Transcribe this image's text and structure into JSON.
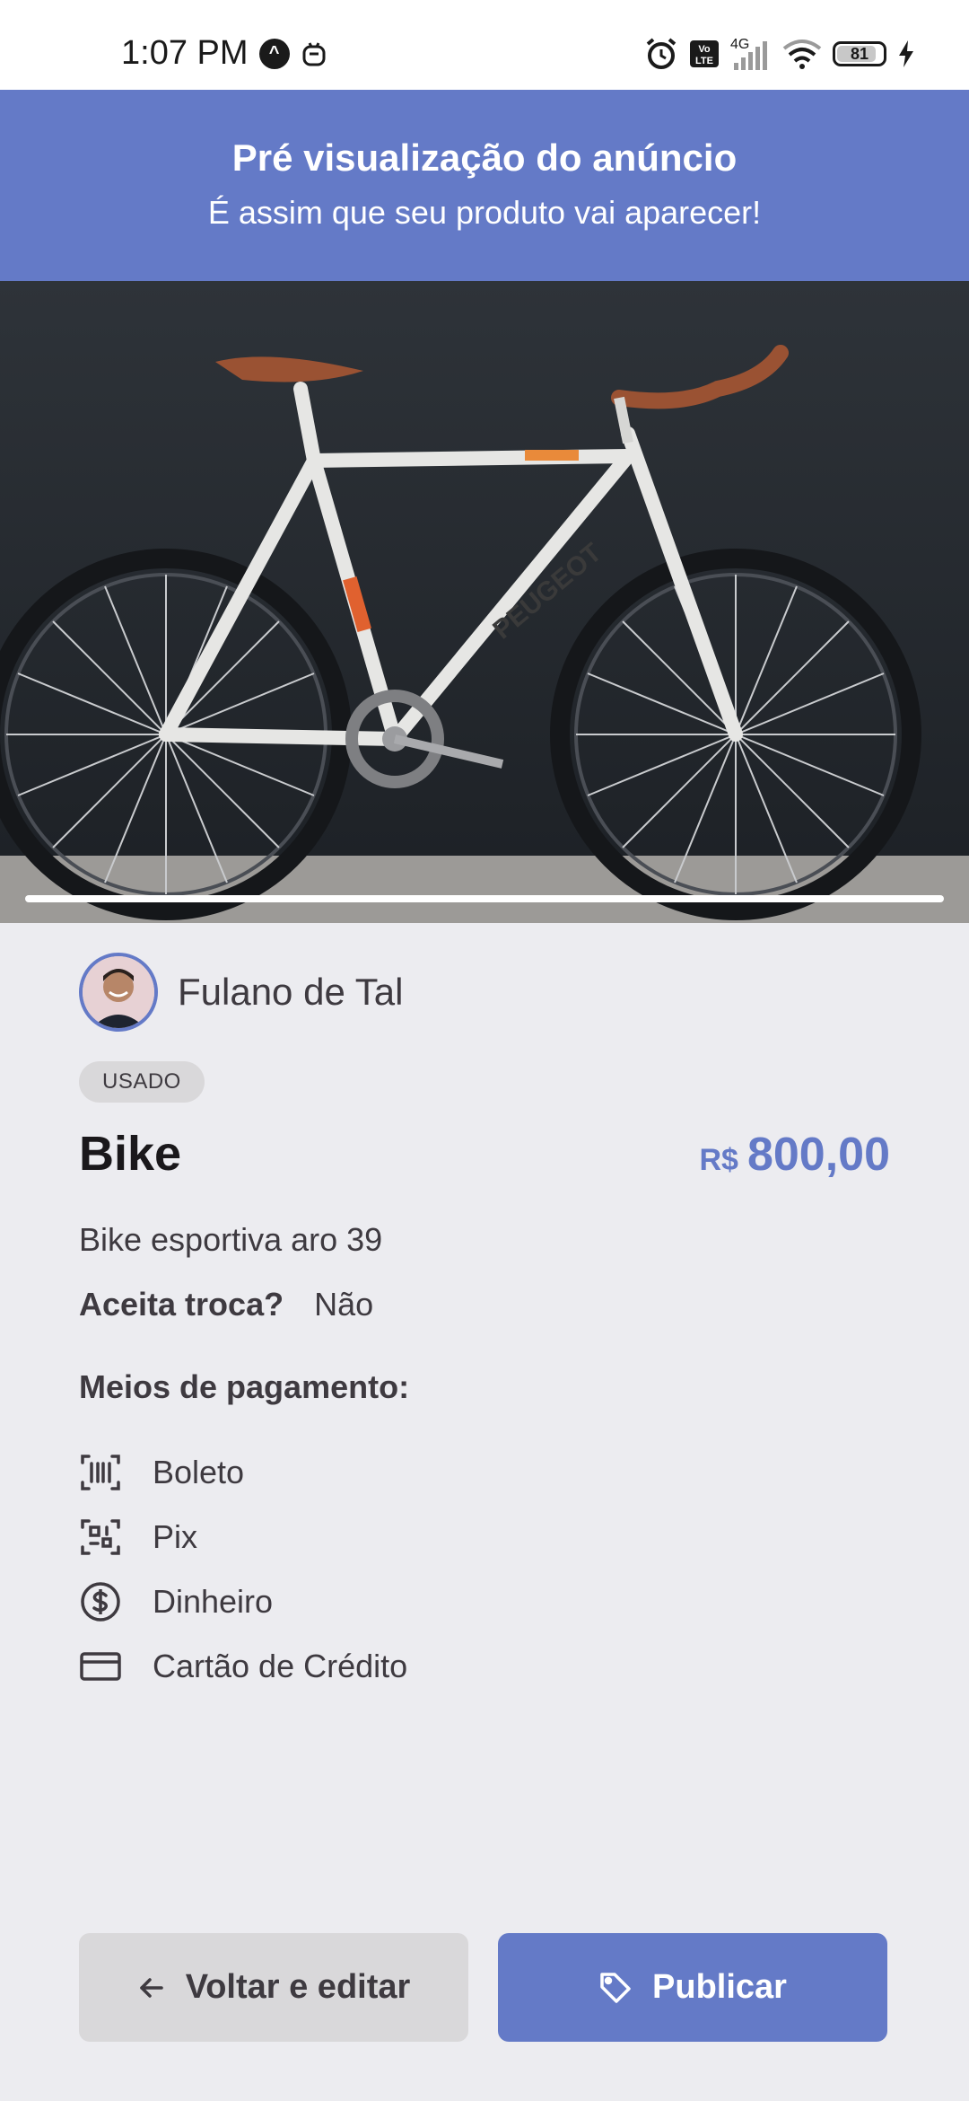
{
  "status_bar": {
    "time": "1:07 PM",
    "network": "4G",
    "volte": "Vo LTE",
    "battery": "81"
  },
  "header": {
    "title": "Pré visualização do anúncio",
    "subtitle": "É assim que seu produto vai aparecer!"
  },
  "seller": {
    "name": "Fulano de Tal"
  },
  "product": {
    "condition": "USADO",
    "title": "Bike",
    "currency": "R$",
    "price": "800,00",
    "description": "Bike esportiva aro 39",
    "trade_label": "Aceita troca?",
    "trade_value": "Não",
    "image_slide_progress": 1.0
  },
  "payment": {
    "title": "Meios de pagamento:",
    "methods": [
      {
        "label": "Boleto",
        "icon": "barcode-icon"
      },
      {
        "label": "Pix",
        "icon": "qr-code-icon"
      },
      {
        "label": "Dinheiro",
        "icon": "money-icon"
      },
      {
        "label": "Cartão de Crédito",
        "icon": "credit-card-icon"
      }
    ]
  },
  "actions": {
    "back_label": "Voltar e editar",
    "publish_label": "Publicar"
  },
  "colors": {
    "accent": "#647AC7",
    "background": "#ECECF0",
    "gray_button": "#D9D8DA",
    "text": "#3E3A40"
  }
}
